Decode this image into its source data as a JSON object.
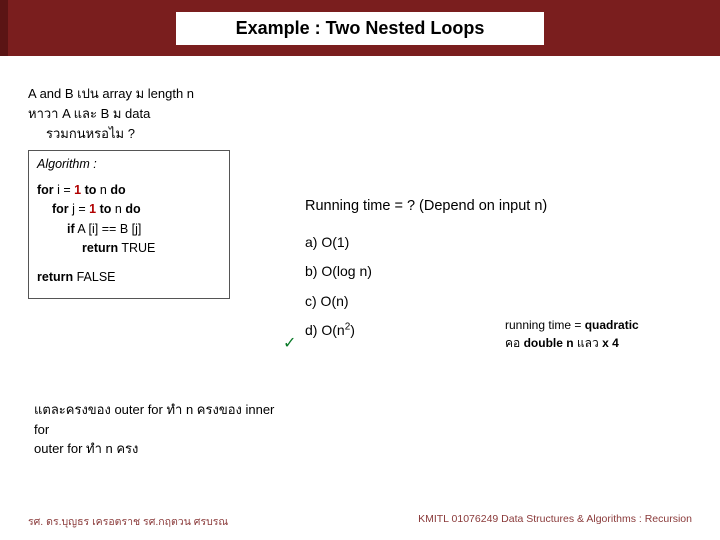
{
  "title": "Example : Two Nested Loops",
  "problem": {
    "line1": "A and B เปน  array ม  length n",
    "line2": "หาวา  A  และ B ม  data",
    "line3": "รวมกนหรอไม          ?"
  },
  "algorithm": {
    "label": "Algorithm :",
    "l1a": "for",
    "l1b": " i  = ",
    "l1c": "1",
    "l1d": " to",
    "l1e": " n ",
    "l1f": "do",
    "l2a": "for",
    "l2b": " j  = ",
    "l2c": "1",
    "l2d": " to",
    "l2e": " n ",
    "l2f": "do",
    "l3a": "if",
    "l3b": "  A [i] == B [j]",
    "l4a": "return",
    "l4b": "  TRUE",
    "l5a": "return",
    "l5b": " FALSE"
  },
  "question": "Running time = ?  (Depend on input n)",
  "options": {
    "a": "a)  O(1)",
    "b": "b)  O(log n)",
    "c": "c)  O(n)",
    "d_pre": "d)  O(n",
    "d_exp": "2",
    "d_post": ")"
  },
  "check": "✓",
  "explain": {
    "l1a": "running time  = ",
    "l1b": "quadratic",
    "l2a": "คอ  ",
    "l2b": "double n",
    "l2c": " แลว  ",
    "l2d": "x 4"
  },
  "notes": {
    "l1": "แตละครงของ       outer  for  ทำ  n  ครงของ       inner",
    "l2": "for",
    "l3": "outer for ทำ  n ครง"
  },
  "footer": {
    "left": "รศ. ดร.บุญธร       เครอตราช        รศ.กฤตวน  ศรบรณ",
    "right": "KMITL     01076249 Data Structures & Algorithms : Recursion"
  }
}
